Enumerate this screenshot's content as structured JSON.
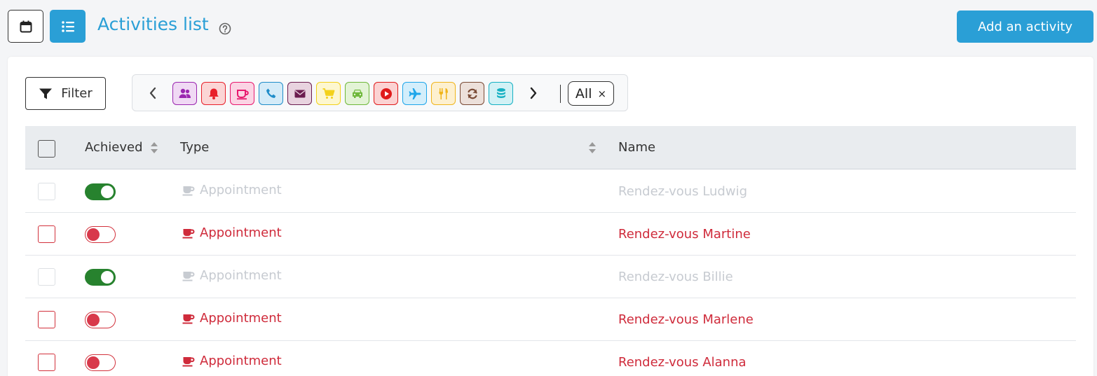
{
  "header": {
    "title": "Activities list",
    "add_label": "Add an activity"
  },
  "filter": {
    "label": "Filter"
  },
  "type_filter": {
    "chips": [
      {
        "icon": "users-icon",
        "color": "#9b27b0",
        "bg": "#f0d9f4"
      },
      {
        "icon": "bell-icon",
        "color": "#e8202a",
        "bg": "#fbd5d5"
      },
      {
        "icon": "coffee-cup-icon",
        "color": "#e8186e",
        "bg": "#fbd4e4"
      },
      {
        "icon": "phone-icon",
        "color": "#1f8cc9",
        "bg": "#d4ebf8"
      },
      {
        "icon": "envelope-icon",
        "color": "#6b1c4f",
        "bg": "#e8d3df"
      },
      {
        "icon": "cart-icon",
        "color": "#f3d11a",
        "bg": "#fdf7cf"
      },
      {
        "icon": "car-icon",
        "color": "#6fb83b",
        "bg": "#e3f3d6"
      },
      {
        "icon": "play-circle-icon",
        "color": "#e01b1b",
        "bg": "#fbd2d2"
      },
      {
        "icon": "airplane-icon",
        "color": "#1ea6ea",
        "bg": "#d3eefb"
      },
      {
        "icon": "cutlery-icon",
        "color": "#f0b51c",
        "bg": "#fdf0cf"
      },
      {
        "icon": "refresh-icon",
        "color": "#7a4a35",
        "bg": "#ece0da"
      },
      {
        "icon": "coins-icon",
        "color": "#15b1c3",
        "bg": "#d2f1f5"
      }
    ],
    "all_label": "All",
    "all_clear": "×"
  },
  "table": {
    "columns": {
      "achieved": "Achieved",
      "type": "Type",
      "name": "Name"
    },
    "rows": [
      {
        "achieved": true,
        "type": "Appointment",
        "name": "Rendez-vous Ludwig"
      },
      {
        "achieved": false,
        "type": "Appointment",
        "name": "Rendez-vous Martine"
      },
      {
        "achieved": true,
        "type": "Appointment",
        "name": "Rendez-vous Billie"
      },
      {
        "achieved": false,
        "type": "Appointment",
        "name": "Rendez-vous Marlene"
      },
      {
        "achieved": false,
        "type": "Appointment",
        "name": "Rendez-vous Alanna"
      }
    ]
  }
}
